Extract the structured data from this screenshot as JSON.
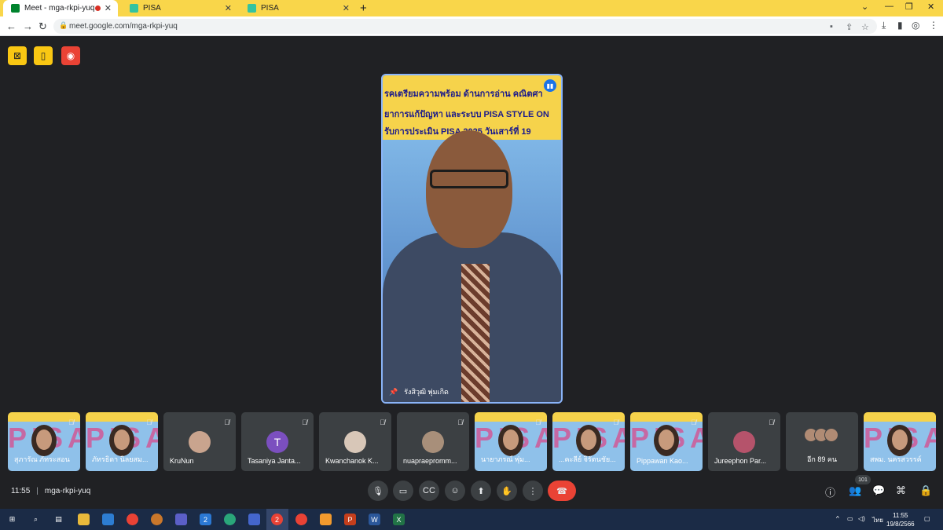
{
  "browser": {
    "tabs": [
      {
        "title": "Meet - mga-rkpi-yuq",
        "active": true,
        "recording": true
      },
      {
        "title": "PISA",
        "active": false
      },
      {
        "title": "PISA",
        "active": false
      }
    ],
    "new_tab": "+",
    "url": "meet.google.com/mga-rkpi-yuq"
  },
  "speaker": {
    "banner_lines": [
      "รคเตรียมความพร้อม ด้านการอ่าน คณิตศา",
      "ยาการแก้ปัญหา และระบบ PISA STYLE ON",
      "รับการประเมิน PISA 2025 วันเสาร์ที่ 19"
    ],
    "name": "รังสิวุฒิ พุ่มเกิด"
  },
  "tiles": [
    {
      "name": "สุภารัณ ภัทระสอน",
      "type": "video"
    },
    {
      "name": "ภัทรธิดา นิลยสม...",
      "type": "video"
    },
    {
      "name": "KruNun",
      "type": "avatar"
    },
    {
      "name": "Tasaniya Janta...",
      "type": "letter",
      "letter": "T"
    },
    {
      "name": "Kwanchanok K...",
      "type": "avatar"
    },
    {
      "name": "nuapraepromm...",
      "type": "avatar"
    },
    {
      "name": "นายาภรณ์ พุ่ม...",
      "type": "video"
    },
    {
      "name": "...คะลีย์ จิรัตนชัย...",
      "type": "video"
    },
    {
      "name": "Pippawan Kao...",
      "type": "video"
    },
    {
      "name": "Jureephon Par...",
      "type": "avatar"
    },
    {
      "name": "อีก 89 คน",
      "type": "more"
    },
    {
      "name": "สพม. นครสวรรค์",
      "type": "video"
    }
  ],
  "meeting": {
    "time": "11:55",
    "separator": "|",
    "code": "mga-rkpi-yuq",
    "participant_count": "101"
  },
  "taskbar": {
    "lang": "ไทย",
    "time": "11:55",
    "date": "19/8/2566",
    "chrome_badge": "2",
    "mail_badge": "2"
  },
  "colors": {
    "tab_bar": "#f9d64a",
    "meet_bg": "#202124",
    "end_call": "#ea4335",
    "active_speaker_border": "#8ab4f8"
  }
}
